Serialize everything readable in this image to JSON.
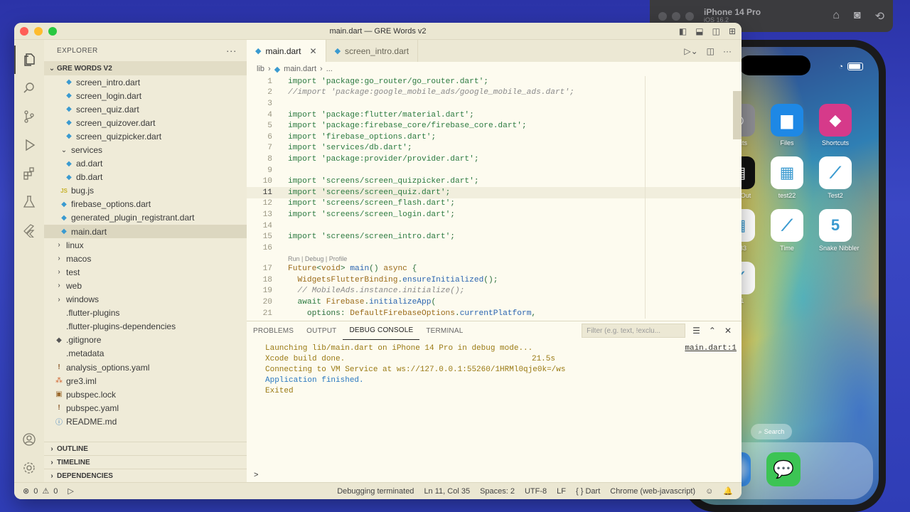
{
  "simulator": {
    "device_name": "iPhone 14 Pro",
    "os_version": "iOS 16.2",
    "icons": [
      "home-icon",
      "screenshot-icon",
      "rotate-icon"
    ]
  },
  "phone": {
    "apps": [
      {
        "label": "ntacts",
        "color": "#8e8e93"
      },
      {
        "label": "Files",
        "color": "#1e88e5"
      },
      {
        "label": "Shortcuts",
        "color": "#d63a8a"
      },
      {
        "label": "BrickOut",
        "color": "#111111"
      },
      {
        "label": "test22",
        "color": "#ffffff"
      },
      {
        "label": "Test2",
        "color": "#ffffff"
      },
      {
        "label": "est33",
        "color": "#ffffff"
      },
      {
        "label": "Time",
        "color": "#ffffff"
      },
      {
        "label": "Snake Nibbler",
        "color": "#ffffff"
      },
      {
        "label": "en1",
        "color": "#ffffff"
      }
    ],
    "search_label": "Search"
  },
  "window": {
    "title": "main.dart — GRE Words v2"
  },
  "sidebar": {
    "header": "EXPLORER",
    "more": "···",
    "project": "GRE WORDS V2",
    "tree": [
      {
        "label": "screen_intro.dart",
        "icon": "dart",
        "indent": 2
      },
      {
        "label": "screen_login.dart",
        "icon": "dart",
        "indent": 2
      },
      {
        "label": "screen_quiz.dart",
        "icon": "dart",
        "indent": 2
      },
      {
        "label": "screen_quizover.dart",
        "icon": "dart",
        "indent": 2
      },
      {
        "label": "screen_quizpicker.dart",
        "icon": "dart",
        "indent": 2
      },
      {
        "label": "services",
        "icon": "chevron-down",
        "indent": 1
      },
      {
        "label": "ad.dart",
        "icon": "dart",
        "indent": 2
      },
      {
        "label": "db.dart",
        "icon": "dart",
        "indent": 2
      },
      {
        "label": "bug.js",
        "icon": "js",
        "indent": 1
      },
      {
        "label": "firebase_options.dart",
        "icon": "dart",
        "indent": 1
      },
      {
        "label": "generated_plugin_registrant.dart",
        "icon": "dart",
        "indent": 1
      },
      {
        "label": "main.dart",
        "icon": "dart",
        "indent": 1,
        "selected": true
      },
      {
        "label": "linux",
        "icon": "chevron-right",
        "indent": 0
      },
      {
        "label": "macos",
        "icon": "chevron-right",
        "indent": 0
      },
      {
        "label": "test",
        "icon": "chevron-right",
        "indent": 0
      },
      {
        "label": "web",
        "icon": "chevron-right",
        "indent": 0
      },
      {
        "label": "windows",
        "icon": "chevron-right",
        "indent": 0
      },
      {
        "label": ".flutter-plugins",
        "icon": "none",
        "indent": 0
      },
      {
        "label": ".flutter-plugins-dependencies",
        "icon": "none",
        "indent": 0
      },
      {
        "label": ".gitignore",
        "icon": "git",
        "indent": 0
      },
      {
        "label": ".metadata",
        "icon": "none",
        "indent": 0
      },
      {
        "label": "analysis_options.yaml",
        "icon": "warn",
        "indent": 0
      },
      {
        "label": "gre3.iml",
        "icon": "xml",
        "indent": 0
      },
      {
        "label": "pubspec.lock",
        "icon": "lock",
        "indent": 0
      },
      {
        "label": "pubspec.yaml",
        "icon": "warn",
        "indent": 0
      },
      {
        "label": "README.md",
        "icon": "info",
        "indent": 0
      }
    ],
    "sections": [
      "OUTLINE",
      "TIMELINE",
      "DEPENDENCIES"
    ]
  },
  "editor": {
    "tabs": [
      {
        "label": "main.dart",
        "active": true
      },
      {
        "label": "screen_intro.dart",
        "active": false
      }
    ],
    "breadcrumb": [
      "lib",
      "main.dart",
      "..."
    ],
    "codelens": "Run | Debug | Profile",
    "lines": [
      {
        "n": "1",
        "text": "import 'package:go_router/go_router.dart';"
      },
      {
        "n": "2",
        "text": "//import 'package:google_mobile_ads/google_mobile_ads.dart';"
      },
      {
        "n": "3",
        "text": ""
      },
      {
        "n": "4",
        "text": "import 'package:flutter/material.dart';"
      },
      {
        "n": "5",
        "text": "import 'package:firebase_core/firebase_core.dart';"
      },
      {
        "n": "6",
        "text": "import 'firebase_options.dart';"
      },
      {
        "n": "7",
        "text": "import 'services/db.dart';"
      },
      {
        "n": "8",
        "text": "import 'package:provider/provider.dart';"
      },
      {
        "n": "9",
        "text": ""
      },
      {
        "n": "10",
        "text": "import 'screens/screen_quizpicker.dart';"
      },
      {
        "n": "11",
        "text": "import 'screens/screen_quiz.dart';"
      },
      {
        "n": "12",
        "text": "import 'screens/screen_flash.dart';"
      },
      {
        "n": "13",
        "text": "import 'screens/screen_login.dart';"
      },
      {
        "n": "14",
        "text": ""
      },
      {
        "n": "15",
        "text": "import 'screens/screen_intro.dart';"
      },
      {
        "n": "16",
        "text": ""
      },
      {
        "n": "17",
        "text": "Future<void> main() async {"
      },
      {
        "n": "18",
        "text": "  WidgetsFlutterBinding.ensureInitialized();"
      },
      {
        "n": "19",
        "text": "  // MobileAds.instance.initialize();"
      },
      {
        "n": "20",
        "text": "  await Firebase.initializeApp("
      },
      {
        "n": "21",
        "text": "    options: DefaultFirebaseOptions.currentPlatform,"
      }
    ],
    "current_line": "11"
  },
  "panel": {
    "tabs": [
      {
        "label": "PROBLEMS",
        "active": false
      },
      {
        "label": "OUTPUT",
        "active": false
      },
      {
        "label": "DEBUG CONSOLE",
        "active": true
      },
      {
        "label": "TERMINAL",
        "active": false
      }
    ],
    "filter_placeholder": "Filter (e.g. text, !exclu...",
    "source_link": "main.dart:1",
    "console": [
      {
        "text": "Launching lib/main.dart on iPhone 14 Pro in debug mode...",
        "right": "",
        "color": "yellow"
      },
      {
        "text": "Xcode build done.",
        "right": "21.5s",
        "color": "yellow"
      },
      {
        "text": "Connecting to VM Service at ws://127.0.0.1:55260/1HRMl0qje0k=/ws",
        "right": "",
        "color": "yellow"
      },
      {
        "text": "Application finished.",
        "right": "",
        "color": "blue"
      },
      {
        "text": "Exited",
        "right": "",
        "color": "yellow"
      }
    ],
    "prompt": ">"
  },
  "statusbar": {
    "errors": "0",
    "warnings": "0",
    "debug_status": "Debugging terminated",
    "position": "Ln 11, Col 35",
    "spaces": "Spaces: 2",
    "encoding": "UTF-8",
    "eol": "LF",
    "language": "Dart",
    "device": "Chrome (web-javascript)"
  }
}
